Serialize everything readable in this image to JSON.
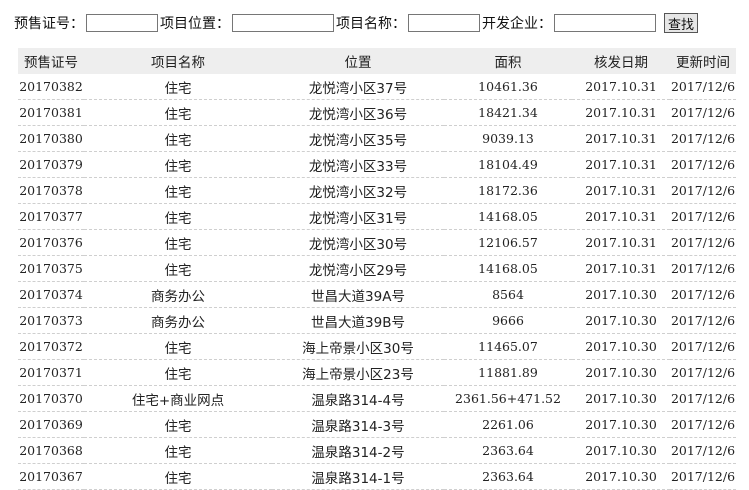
{
  "search": {
    "presale_label": "预售证号：",
    "location_label": "项目位置：",
    "name_label": "项目名称：",
    "developer_label": "开发企业：",
    "search_button": "查找"
  },
  "table": {
    "headers": [
      "预售证号",
      "项目名称",
      "位置",
      "面积",
      "核发日期",
      "更新时间"
    ],
    "rows": [
      [
        "20170382",
        "住宅",
        "龙悦湾小区37号",
        "10461.36",
        "2017.10.31",
        "2017/12/6"
      ],
      [
        "20170381",
        "住宅",
        "龙悦湾小区36号",
        "18421.34",
        "2017.10.31",
        "2017/12/6"
      ],
      [
        "20170380",
        "住宅",
        "龙悦湾小区35号",
        "9039.13",
        "2017.10.31",
        "2017/12/6"
      ],
      [
        "20170379",
        "住宅",
        "龙悦湾小区33号",
        "18104.49",
        "2017.10.31",
        "2017/12/6"
      ],
      [
        "20170378",
        "住宅",
        "龙悦湾小区32号",
        "18172.36",
        "2017.10.31",
        "2017/12/6"
      ],
      [
        "20170377",
        "住宅",
        "龙悦湾小区31号",
        "14168.05",
        "2017.10.31",
        "2017/12/6"
      ],
      [
        "20170376",
        "住宅",
        "龙悦湾小区30号",
        "12106.57",
        "2017.10.31",
        "2017/12/6"
      ],
      [
        "20170375",
        "住宅",
        "龙悦湾小区29号",
        "14168.05",
        "2017.10.31",
        "2017/12/6"
      ],
      [
        "20170374",
        "商务办公",
        "世昌大道39A号",
        "8564",
        "2017.10.30",
        "2017/12/6"
      ],
      [
        "20170373",
        "商务办公",
        "世昌大道39B号",
        "9666",
        "2017.10.30",
        "2017/12/6"
      ],
      [
        "20170372",
        "住宅",
        "海上帝景小区30号",
        "11465.07",
        "2017.10.30",
        "2017/12/6"
      ],
      [
        "20170371",
        "住宅",
        "海上帝景小区23号",
        "11881.89",
        "2017.10.30",
        "2017/12/6"
      ],
      [
        "20170370",
        "住宅+商业网点",
        "温泉路314-4号",
        "2361.56+471.52",
        "2017.10.30",
        "2017/12/6"
      ],
      [
        "20170369",
        "住宅",
        "温泉路314-3号",
        "2261.06",
        "2017.10.30",
        "2017/12/6"
      ],
      [
        "20170368",
        "住宅",
        "温泉路314-2号",
        "2363.64",
        "2017.10.30",
        "2017/12/6"
      ],
      [
        "20170367",
        "住宅",
        "温泉路314-1号",
        "2363.64",
        "2017.10.30",
        "2017/12/6"
      ]
    ]
  }
}
